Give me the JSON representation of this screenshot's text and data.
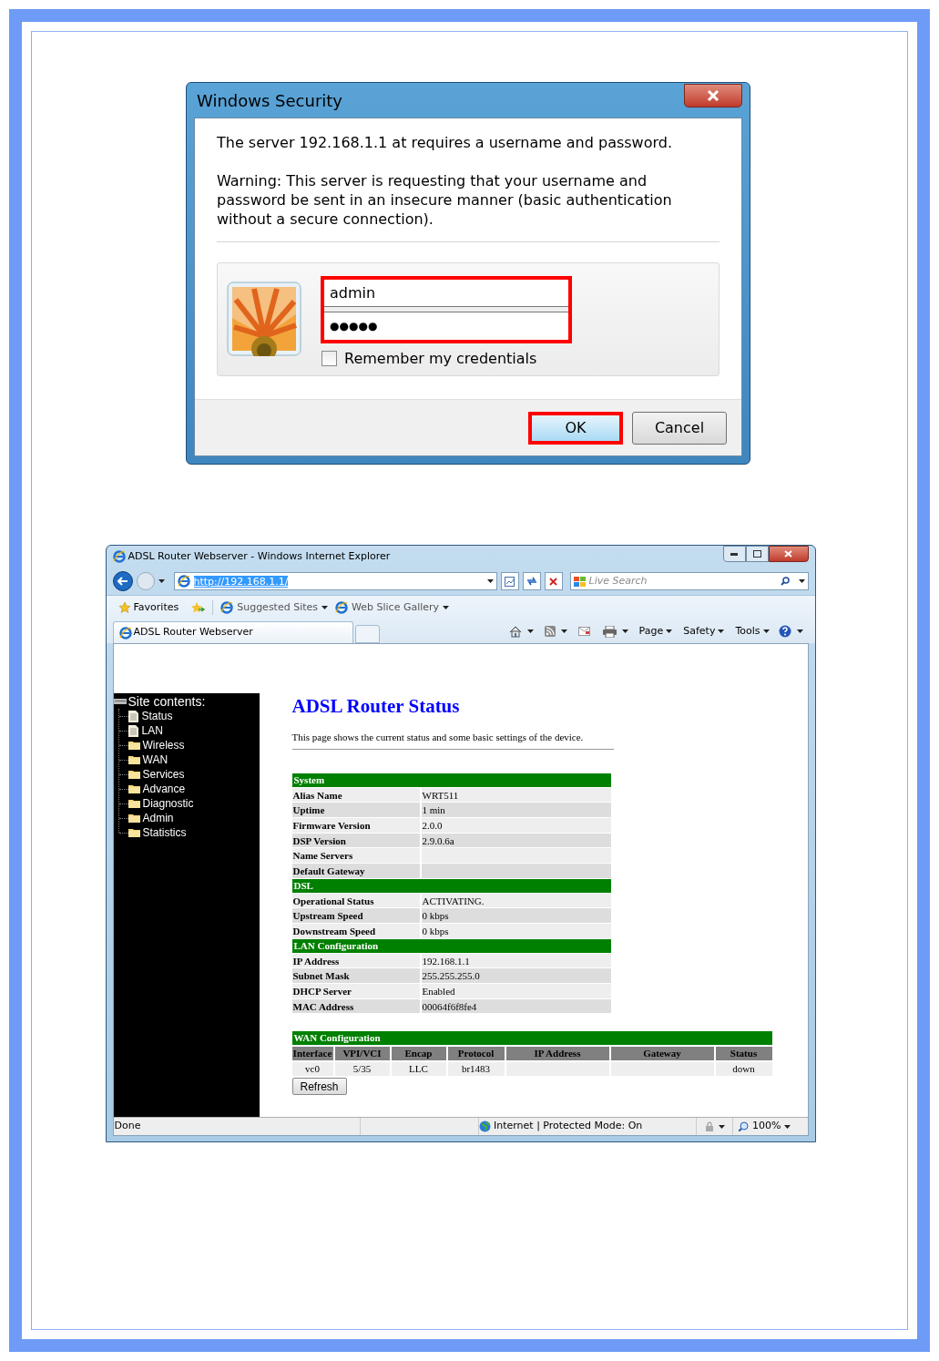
{
  "dialog": {
    "title": "Windows Security",
    "message": "The server 192.168.1.1 at  requires a username and password.",
    "warning": "Warning: This server is requesting that your username and password be sent in an insecure manner (basic authentication without a secure connection).",
    "username": "admin",
    "password": "●●●●●",
    "fields_highlighted": true,
    "remember": {
      "label": "Remember my credentials",
      "checked": false
    },
    "buttons": [
      {
        "label": "OK",
        "highlighted": true
      },
      {
        "label": "Cancel",
        "highlighted": false
      }
    ]
  },
  "browser": {
    "title": "ADSL Router Webserver - Windows Internet Explorer",
    "address": "http://192.168.1.1/",
    "search": {
      "placeholder": "Live Search"
    },
    "favorites_bar": [
      {
        "label": "Favorites",
        "kind": "star"
      },
      {
        "label": "Suggested Sites",
        "kind": "link"
      },
      {
        "label": "Web Slice Gallery",
        "kind": "link"
      }
    ],
    "tab": "ADSL Router Webserver",
    "command_bar": [
      "Page",
      "Safety",
      "Tools"
    ],
    "sidebar": {
      "heading": "Site contents:",
      "items": [
        {
          "label": "Status",
          "kind": "page"
        },
        {
          "label": "LAN",
          "kind": "page"
        },
        {
          "label": "Wireless",
          "kind": "folder"
        },
        {
          "label": "WAN",
          "kind": "folder"
        },
        {
          "label": "Services",
          "kind": "folder"
        },
        {
          "label": "Advance",
          "kind": "folder"
        },
        {
          "label": "Diagnostic",
          "kind": "folder"
        },
        {
          "label": "Admin",
          "kind": "folder"
        },
        {
          "label": "Statistics",
          "kind": "folder"
        }
      ]
    },
    "page": {
      "heading": "ADSL Router Status",
      "description": "This page shows the current status and some basic settings of the device.",
      "sections": [
        {
          "title": "System",
          "rows": [
            [
              "Alias Name",
              "WRT511"
            ],
            [
              "Uptime",
              "1 min"
            ],
            [
              "Firmware Version",
              "2.0.0"
            ],
            [
              "DSP Version",
              "2.9.0.6a"
            ],
            [
              "Name Servers",
              ""
            ],
            [
              "Default Gateway",
              ""
            ]
          ]
        },
        {
          "title": "DSL",
          "rows": [
            [
              "Operational Status",
              "ACTIVATING."
            ],
            [
              "Upstream Speed",
              "0 kbps"
            ],
            [
              "Downstream Speed",
              "0 kbps"
            ]
          ]
        },
        {
          "title": "LAN Configuration",
          "rows": [
            [
              "IP Address",
              "192.168.1.1"
            ],
            [
              "Subnet Mask",
              "255.255.255.0"
            ],
            [
              "DHCP Server",
              "Enabled"
            ],
            [
              "MAC Address",
              "00064f6f8fe4"
            ]
          ]
        }
      ],
      "wan": {
        "title": "WAN Configuration",
        "columns": [
          "Interface",
          "VPI/VCI",
          "Encap",
          "Protocol",
          "IP Address",
          "Gateway",
          "Status"
        ],
        "rows": [
          [
            "vc0",
            "5/35",
            "LLC",
            "br1483",
            "",
            "",
            "down"
          ]
        ]
      },
      "refresh": "Refresh"
    },
    "status_bar": {
      "status": "Done",
      "zone": "Internet | Protected Mode: On",
      "zoom": "100%"
    }
  }
}
